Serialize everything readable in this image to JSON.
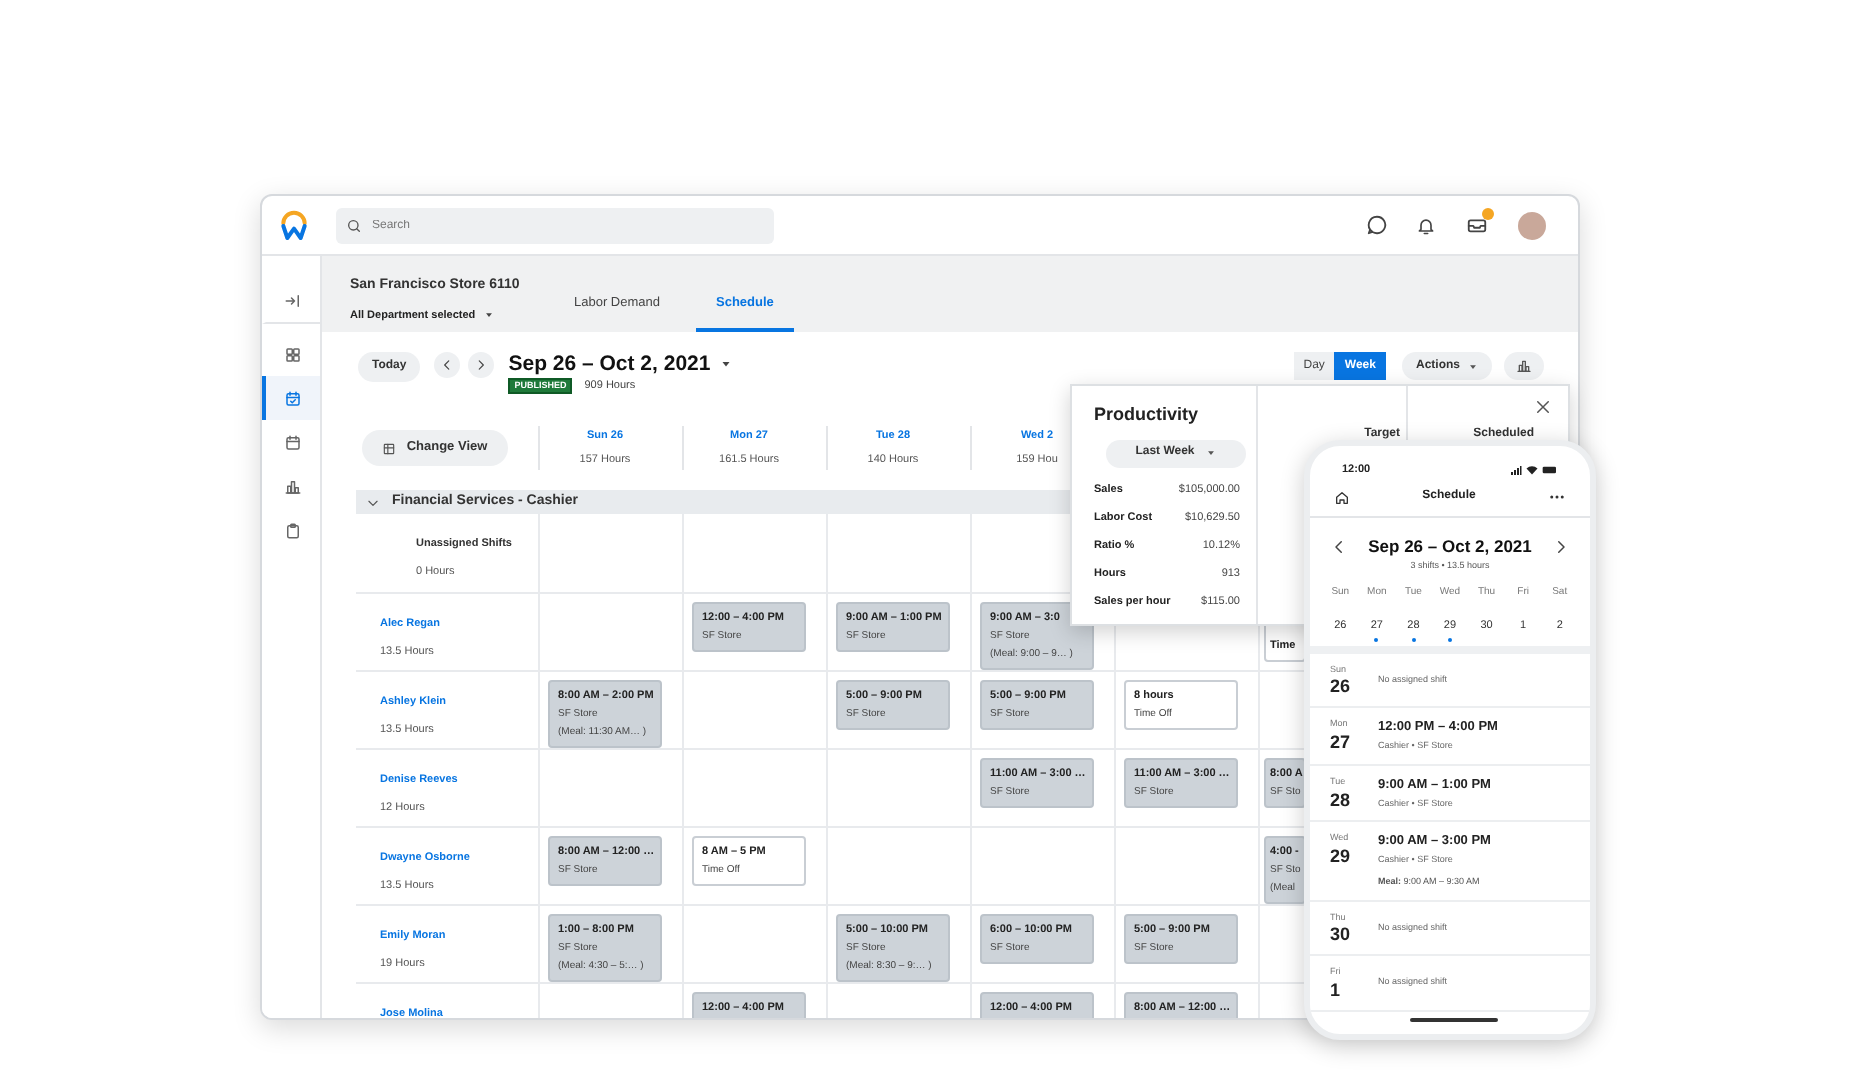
{
  "topbar": {
    "search": {
      "placeholder": "Search"
    }
  },
  "sidebar": {
    "items": [
      {
        "kind": "collapse",
        "selected": false
      },
      {
        "kind": "dashboard",
        "selected": false
      },
      {
        "kind": "calendar_check",
        "selected": true
      },
      {
        "kind": "calendar",
        "selected": false
      },
      {
        "kind": "chart",
        "selected": false
      },
      {
        "kind": "clipboard",
        "selected": false
      }
    ]
  },
  "store": {
    "title": "San Francisco Store 6110",
    "department": "All Department selected"
  },
  "tabs": [
    {
      "label": "Labor Demand",
      "selected": false
    },
    {
      "label": "Schedule",
      "selected": true
    }
  ],
  "toolbar": {
    "today": "Today",
    "date_range": "Sep 26 – Oct 2, 2021",
    "status": "PUBLISHED",
    "total_hours": "909 Hours",
    "view_modes": [
      {
        "label": "Day",
        "selected": false
      },
      {
        "label": "Week",
        "selected": true
      }
    ],
    "actions": "Actions",
    "change_view": "Change View"
  },
  "schedule": {
    "days": [
      {
        "label": "Sun 26",
        "hours": "157 Hours"
      },
      {
        "label": "Mon 27",
        "hours": "161.5 Hours"
      },
      {
        "label": "Tue 28",
        "hours": "140 Hours"
      },
      {
        "label": "Wed 2",
        "hours": "159 Hou"
      }
    ],
    "group": {
      "title": "Financial Services - Cashier",
      "expanded": true
    },
    "rows": [
      {
        "kind": "unassigned",
        "name": "Unassigned Shifts",
        "hours": "0 Hours",
        "cells": [
          {
            "kind": "empty"
          },
          {
            "kind": "empty"
          },
          {
            "kind": "empty"
          },
          {
            "kind": "empty"
          },
          {
            "kind": "empty"
          },
          {
            "kind": "empty"
          }
        ]
      },
      {
        "kind": "employee",
        "name": "Alec Regan",
        "hours": "13.5 Hours",
        "cells": [
          {
            "kind": "empty"
          },
          {
            "kind": "shift",
            "lines": [
              "12:00 – 4:00 PM",
              "SF Store"
            ]
          },
          {
            "kind": "shift",
            "lines": [
              "9:00 AM – 1:00 PM",
              "SF Store"
            ]
          },
          {
            "kind": "shift",
            "lines": [
              "9:00 AM – 3:0",
              "SF Store",
              "(Meal: 9:00 – 9… )"
            ]
          },
          {
            "kind": "empty"
          },
          {
            "kind": "time_off",
            "lines": [
              "Time"
            ]
          }
        ]
      },
      {
        "kind": "employee",
        "name": "Ashley Klein",
        "hours": "13.5 Hours",
        "cells": [
          {
            "kind": "shift",
            "lines": [
              "8:00 AM – 2:00 PM",
              "SF Store",
              "(Meal: 11:30 AM… )"
            ]
          },
          {
            "kind": "empty"
          },
          {
            "kind": "shift",
            "lines": [
              "5:00 – 9:00 PM",
              "SF Store"
            ]
          },
          {
            "kind": "shift",
            "lines": [
              "5:00 – 9:00 PM",
              "SF Store"
            ]
          },
          {
            "kind": "time_off",
            "lines": [
              "8 hours",
              "Time Off"
            ]
          },
          {
            "kind": "empty"
          }
        ]
      },
      {
        "kind": "employee",
        "name": "Denise Reeves",
        "hours": "12 Hours",
        "cells": [
          {
            "kind": "empty"
          },
          {
            "kind": "empty"
          },
          {
            "kind": "empty"
          },
          {
            "kind": "shift",
            "lines": [
              "11:00 AM – 3:00 …",
              "SF Store"
            ]
          },
          {
            "kind": "shift",
            "lines": [
              "11:00 AM – 3:00 …",
              "SF Store"
            ]
          },
          {
            "kind": "shift",
            "lines": [
              "8:00 A",
              "SF Sto"
            ]
          }
        ]
      },
      {
        "kind": "employee",
        "name": "Dwayne Osborne",
        "hours": "13.5 Hours",
        "cells": [
          {
            "kind": "shift",
            "lines": [
              "8:00 AM – 12:00 …",
              "SF Store"
            ]
          },
          {
            "kind": "time_off",
            "lines": [
              "8 AM – 5 PM",
              "Time Off"
            ]
          },
          {
            "kind": "empty"
          },
          {
            "kind": "empty"
          },
          {
            "kind": "empty"
          },
          {
            "kind": "shift",
            "lines": [
              "4:00 -",
              "SF Sto",
              "(Meal"
            ]
          }
        ]
      },
      {
        "kind": "employee",
        "name": "Emily Moran",
        "hours": "19 Hours",
        "cells": [
          {
            "kind": "shift",
            "lines": [
              "1:00 – 8:00 PM",
              "SF Store",
              "(Meal: 4:30 – 5:… )"
            ]
          },
          {
            "kind": "empty"
          },
          {
            "kind": "shift",
            "lines": [
              "5:00 – 10:00 PM",
              "SF Store",
              "(Meal: 8:30 – 9:… )"
            ]
          },
          {
            "kind": "shift",
            "lines": [
              "6:00 – 10:00 PM",
              "SF Store"
            ]
          },
          {
            "kind": "shift",
            "lines": [
              "5:00 – 9:00 PM",
              "SF Store"
            ]
          },
          {
            "kind": "empty"
          }
        ]
      },
      {
        "kind": "employee",
        "name": "Jose Molina",
        "cells": [
          {
            "kind": "empty"
          },
          {
            "kind": "shift",
            "lines": [
              "12:00 – 4:00 PM"
            ]
          },
          {
            "kind": "empty"
          },
          {
            "kind": "shift",
            "lines": [
              "12:00 – 4:00 PM"
            ]
          },
          {
            "kind": "shift",
            "lines": [
              "8:00 AM – 12:00 …"
            ]
          },
          {
            "kind": "empty"
          }
        ]
      }
    ]
  },
  "productivity": {
    "title": "Productivity",
    "period": "Last Week",
    "metrics": [
      {
        "label": "Sales",
        "value": "$105,000.00"
      },
      {
        "label": "Labor Cost",
        "value": "$10,629.50"
      },
      {
        "label": "Ratio %",
        "value": "10.12%"
      },
      {
        "label": "Hours",
        "value": "913"
      },
      {
        "label": "Sales per hour",
        "value": "$115.00"
      }
    ],
    "columns": [
      "Target",
      "Scheduled"
    ]
  },
  "phone": {
    "time": "12:00",
    "title": "Schedule",
    "date_range": "Sep 26 – Oct 2, 2021",
    "summary": "3 shifts • 13.5 hours",
    "week": [
      {
        "weekday": "Sun",
        "date": "26",
        "has_shift": false
      },
      {
        "weekday": "Mon",
        "date": "27",
        "has_shift": true
      },
      {
        "weekday": "Tue",
        "date": "28",
        "has_shift": true
      },
      {
        "weekday": "Wed",
        "date": "29",
        "has_shift": true
      },
      {
        "weekday": "Thu",
        "date": "30",
        "has_shift": false
      },
      {
        "weekday": "Fri",
        "date": "1",
        "has_shift": false
      },
      {
        "weekday": "Sat",
        "date": "2",
        "has_shift": false
      }
    ],
    "days": [
      {
        "weekday": "Sun",
        "date": "26",
        "kind": "none",
        "note": "No assigned shift"
      },
      {
        "weekday": "Mon",
        "date": "27",
        "kind": "shift",
        "time": "12:00 PM – 4:00 PM",
        "detail": "Cashier • SF Store"
      },
      {
        "weekday": "Tue",
        "date": "28",
        "kind": "shift",
        "time": "9:00 AM – 1:00 PM",
        "detail": "Cashier • SF Store"
      },
      {
        "weekday": "Wed",
        "date": "29",
        "kind": "shift",
        "time": "9:00 AM – 3:00 PM",
        "detail": "Cashier • SF Store",
        "meal": "**Meal:** 9:00 AM – 9:30 AM"
      },
      {
        "weekday": "Thu",
        "date": "30",
        "kind": "none",
        "note": "No assigned shift"
      },
      {
        "weekday": "Fri",
        "date": "1",
        "kind": "none",
        "note": "No assigned shift"
      }
    ]
  }
}
